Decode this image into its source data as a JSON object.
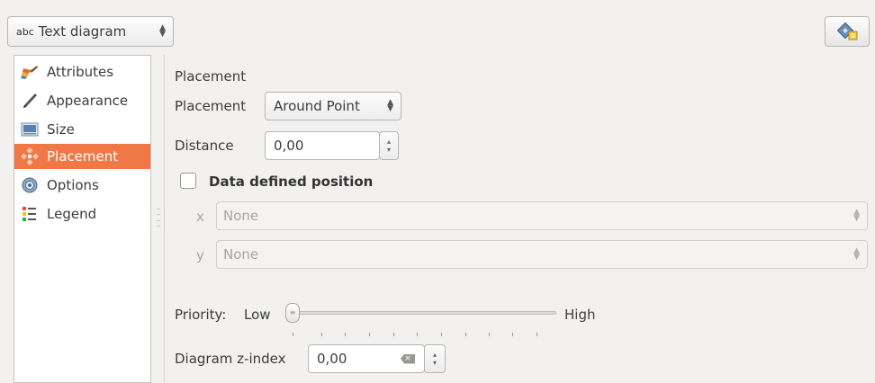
{
  "top": {
    "diagram_type_icon": "abc",
    "diagram_type": "Text diagram",
    "tool_button_icon": "diagram-settings-icon"
  },
  "sidebar": {
    "items": [
      {
        "label": "Attributes",
        "icon": "paintbrush-icon"
      },
      {
        "label": "Appearance",
        "icon": "pen-icon"
      },
      {
        "label": "Size",
        "icon": "size-icon"
      },
      {
        "label": "Placement",
        "icon": "placement-icon",
        "selected": true
      },
      {
        "label": "Options",
        "icon": "gear-icon"
      },
      {
        "label": "Legend",
        "icon": "legend-icon"
      }
    ]
  },
  "placement": {
    "section_title": "Placement",
    "placement_label": "Placement",
    "placement_value": "Around Point",
    "distance_label": "Distance",
    "distance_value": "0,00",
    "data_defined_label": "Data defined position",
    "data_defined_checked": false,
    "x_label": "x",
    "x_value": "None",
    "y_label": "y",
    "y_value": "None",
    "priority_label": "Priority:",
    "priority_low": "Low",
    "priority_high": "High",
    "priority_level": 0,
    "zindex_label": "Diagram z-index",
    "zindex_value": "0,00"
  },
  "colors": {
    "accent": "#f07746",
    "background": "#f2f1f0"
  }
}
